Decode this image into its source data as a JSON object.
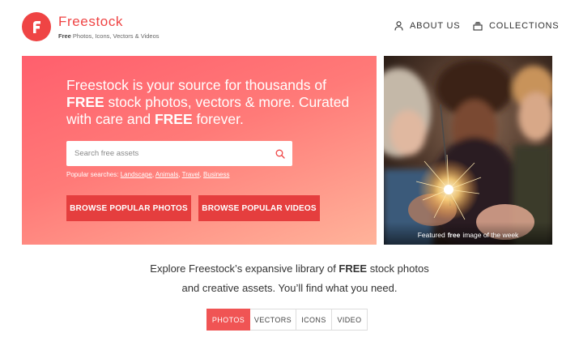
{
  "brand": {
    "name": "Freestock",
    "tagline_bold": "Free",
    "tagline_rest": " Photos, Icons, Vectors & Videos",
    "logo_letter": "F",
    "accent_color": "#ef4444"
  },
  "nav": {
    "about": "ABOUT US",
    "collections": "COLLECTIONS"
  },
  "hero": {
    "line1_a": "Freestock is your source for thousands of ",
    "line1_bold": "FREE",
    "line1_b": " stock photos, vectors & more. Curated with care and ",
    "line2_bold": "FREE",
    "line2_b": " forever.",
    "search_placeholder": "Search free assets",
    "popular_label": "Popular searches: ",
    "popular_links": [
      "Landscape",
      "Animals",
      "Travel",
      "Business"
    ],
    "btn_photos": "BROWSE POPULAR PHOTOS",
    "btn_videos": "BROWSE POPULAR VIDEOS"
  },
  "feature": {
    "caption_a": "Featured",
    "caption_bold": "free",
    "caption_b": "image of the week"
  },
  "tagline": {
    "line1_a": "Explore Freestock’s expansive library of ",
    "line1_bold": "FREE",
    "line1_b": " stock photos",
    "line2": "and creative assets. You’ll find what you need."
  },
  "tabs": [
    "PHOTOS",
    "VECTORS",
    "ICONS",
    "VIDEO"
  ],
  "active_tab": "PHOTOS"
}
